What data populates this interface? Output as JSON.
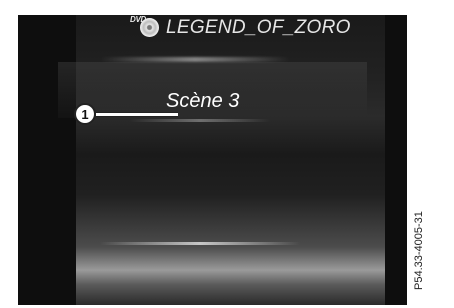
{
  "header": {
    "disc_badge": "DVD",
    "disc_title": "LEGEND_OF_ZORO"
  },
  "main": {
    "current_scene": "Scène 3"
  },
  "callout": {
    "number": "1"
  },
  "figure_ref": "P54.33-4005-31",
  "colors": {
    "screen_background": "#1d1d1d",
    "text": "#ffffff",
    "title_text": "#e6e6e6"
  },
  "icons": {
    "disc": "dvd-disc-icon"
  }
}
